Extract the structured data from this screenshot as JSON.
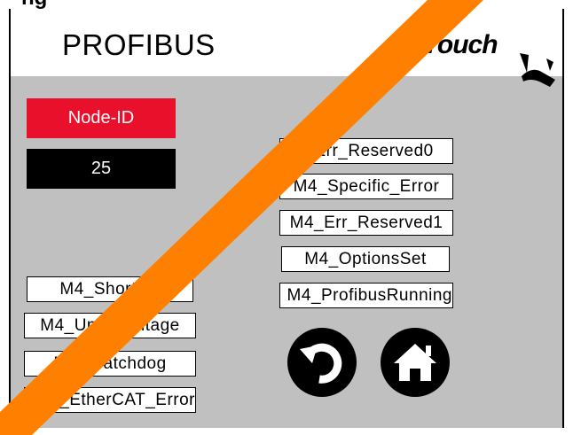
{
  "header": {
    "top_fragment": "ng",
    "title": "PROFIBUS",
    "logo_text": "giTouch",
    "logo_icon": "hand-pointer-logo-icon"
  },
  "node": {
    "label": "Node-ID",
    "value": "25"
  },
  "right_status": [
    "M4_Err_Reserved0",
    "M4_Specific_Error",
    "M4_Err_Reserved1",
    "M4_OptionsSet",
    "M4_ProfibusRunning"
  ],
  "left_status": [
    "M4_Shortcut",
    "M4_Undervoltage",
    "M4_Watchdog",
    "M4_EtherCAT_Error"
  ],
  "buttons": {
    "back_icon": "return-arrow-icon",
    "home_icon": "home-icon"
  },
  "colors": {
    "background": "#c0c0c0",
    "node_label_bg": "#e8102a",
    "node_value_bg": "#000000",
    "stripe": "#ff8000"
  }
}
